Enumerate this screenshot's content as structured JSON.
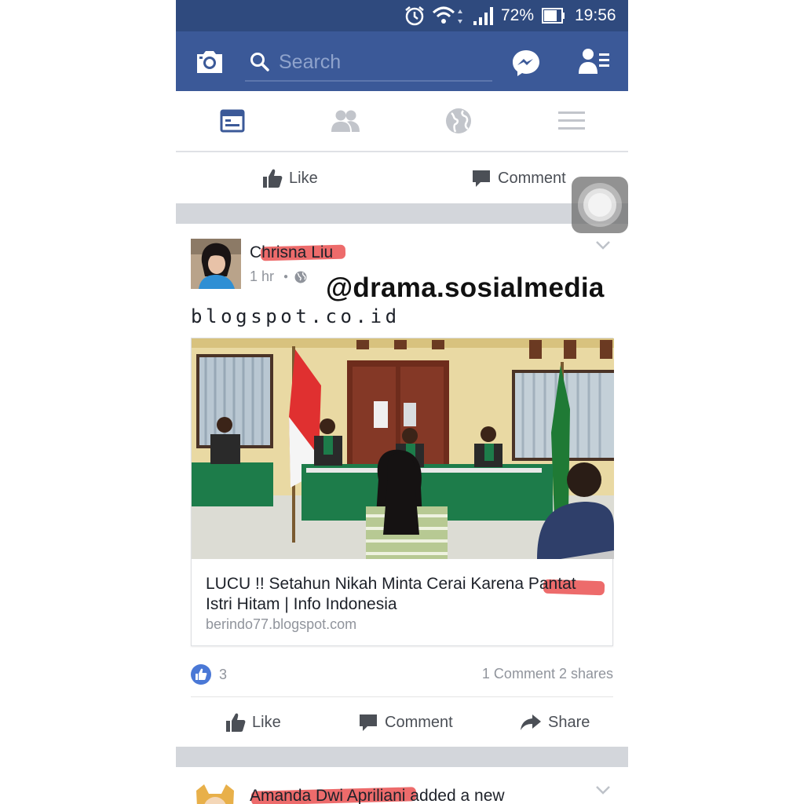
{
  "status_bar": {
    "battery": "72%",
    "time": "19:56",
    "icons": [
      "alarm-icon",
      "wifi-icon",
      "signal-icon",
      "battery-icon"
    ]
  },
  "header": {
    "search_placeholder": "Search",
    "icons": [
      "camera-icon",
      "search-icon",
      "messenger-icon",
      "friend-requests-icon"
    ],
    "brand_color": "#3b5998"
  },
  "tabs": [
    {
      "icon": "news-feed-icon",
      "active": true
    },
    {
      "icon": "friends-icon",
      "active": false
    },
    {
      "icon": "globe-notifications-icon",
      "active": false
    },
    {
      "icon": "menu-icon",
      "active": false
    }
  ],
  "top_actions": {
    "like_label": "Like",
    "comment_label": "Comment"
  },
  "post": {
    "author": "Chrisna Liu",
    "time": "1 hr",
    "privacy_icon": "globe-icon",
    "watermark": "@drama.sosialmedia",
    "text": "blogspot.co.id",
    "link": {
      "title": "LUCU !! Setahun Nikah Minta Cerai Karena Pantat Istri Hitam | Info Indonesia",
      "domain": "berindo77.blogspot.com"
    },
    "like_count": "3",
    "comments_shares": "1 Comment 2 shares",
    "actions": {
      "like_label": "Like",
      "comment_label": "Comment",
      "share_label": "Share"
    }
  },
  "next_post": {
    "author": "Amanda Dwi Apriliani",
    "action_text": " added a new"
  }
}
